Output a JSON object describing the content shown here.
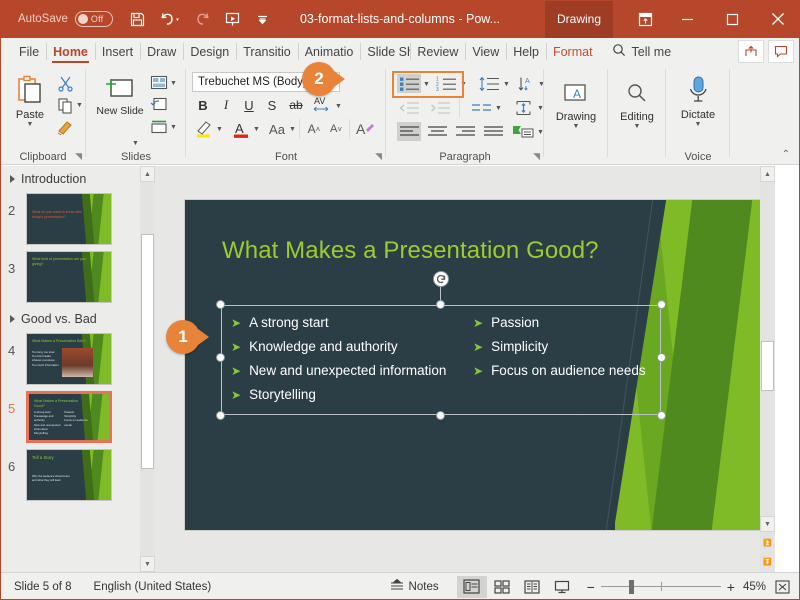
{
  "titlebar": {
    "autosave_label": "AutoSave",
    "autosave_state": "Off",
    "document_title": "03-format-lists-and-columns  -  Pow...",
    "context_tab": "Drawing",
    "quick_access": [
      "save-icon",
      "undo-icon",
      "redo-icon",
      "start-presentation-icon",
      "customize-qat-icon"
    ],
    "window_buttons": [
      "ribbon-display-options",
      "minimize",
      "maximize",
      "close"
    ]
  },
  "tabs": [
    {
      "label": "File",
      "state": "normal"
    },
    {
      "label": "Home",
      "state": "active"
    },
    {
      "label": "Insert",
      "state": "normal"
    },
    {
      "label": "Draw",
      "state": "normal"
    },
    {
      "label": "Design",
      "state": "normal"
    },
    {
      "label": "Transitio",
      "state": "normal"
    },
    {
      "label": "Animatio",
      "state": "normal"
    },
    {
      "label": "Slide Sho",
      "state": "normal"
    },
    {
      "label": "Review",
      "state": "normal"
    },
    {
      "label": "View",
      "state": "normal"
    },
    {
      "label": "Help",
      "state": "normal"
    },
    {
      "label": "Format",
      "state": "contextual"
    }
  ],
  "tellme": {
    "label": "Tell me",
    "icon": "search-icon"
  },
  "ribbon": {
    "groups": [
      {
        "name": "Clipboard",
        "label": "Clipboard"
      },
      {
        "name": "Slides",
        "label": "Slides"
      },
      {
        "name": "Font",
        "label": "Font"
      },
      {
        "name": "Paragraph",
        "label": "Paragraph"
      },
      {
        "name": "Drawing",
        "label": ""
      },
      {
        "name": "Editing",
        "label": ""
      },
      {
        "name": "Voice",
        "label": "Voice"
      }
    ],
    "clipboard": {
      "paste_label": "Paste",
      "cut": "scissors-icon",
      "copy": "copy-icon",
      "format_painter": "format-painter-icon"
    },
    "slides": {
      "new_slide_label": "New Slide",
      "layout": "layout-icon",
      "reset": "reset-icon",
      "section": "section-icon"
    },
    "font": {
      "font_name": "Trebuchet MS (Body)",
      "bold": "B",
      "italic": "I",
      "underline": "U",
      "shadow": "S",
      "strikethrough": "ab",
      "character_spacing": "AV",
      "text_highlight": "highlight-icon",
      "font_color": "A",
      "change_case": "Aa",
      "grow_font": "A",
      "shrink_font": "A",
      "clear_formatting": "clear-formatting-icon"
    },
    "paragraph": {
      "bullets": "bullets-icon",
      "numbering": "numbering-icon",
      "line_spacing": "line-spacing-icon",
      "text_direction_sort": "sort-icon",
      "decrease_indent": "decrease-indent-icon",
      "increase_indent": "increase-indent-icon",
      "columns": "columns-icon",
      "align_text": "align-text-icon",
      "align_left": "align-left-icon",
      "align_center": "align-center-icon",
      "align_right": "align-right-icon",
      "justify": "justify-icon",
      "convert_smartart": "smartart-icon",
      "bullets_active": true,
      "align_left_active": true
    },
    "drawing": {
      "label": "Drawing",
      "icon": "shapes-text-icon"
    },
    "editing": {
      "label": "Editing",
      "icon": "search-icon"
    },
    "voice": {
      "label": "Dictate",
      "icon": "microphone-icon"
    },
    "collapse_ribbon": "chevron-up-icon"
  },
  "callouts": [
    {
      "number": "1",
      "target": "text-box-left-handle"
    },
    {
      "number": "2",
      "target": "bullets-button"
    }
  ],
  "thumbnails": {
    "sections": [
      {
        "name": "Introduction",
        "expanded": true
      },
      {
        "name": "Good vs. Bad",
        "expanded": true
      }
    ],
    "slides": [
      {
        "number": "2",
        "title": "What do you want to know after today's presentation?",
        "selected": false,
        "title_color": "#e05a30",
        "lines": []
      },
      {
        "number": "3",
        "title": "What kind of presentation are you giving?",
        "selected": false,
        "title_color": "#8cc63e",
        "lines": []
      },
      {
        "number": "4",
        "title": "What Makes a Presentation Bad?",
        "selected": false,
        "title_color": "#8cc63e",
        "lines": [
          "Too long, too slow",
          "Too few breaks",
          "Lifeless monotone",
          "Too much information"
        ],
        "has_photo": true
      },
      {
        "number": "5",
        "title": "What Makes a Presentation Good?",
        "selected": true,
        "title_color": "#8cc63e",
        "lines": [
          "A strong start",
          "Knowledge and authority",
          "New and unexpected information",
          "Storytelling"
        ],
        "lines2": [
          "Passion",
          "Simplicity",
          "Focus on audience needs"
        ]
      },
      {
        "number": "6",
        "title": "Tell a Story",
        "selected": false,
        "title_color": "#8cc63e",
        "lines": [
          "Why the audience should care",
          "and what they will learn"
        ]
      }
    ]
  },
  "slide": {
    "title": "What Makes a Presentation Good?",
    "title_color": "#9acd32",
    "background_color": "#2b3d45",
    "bullet_glyph": "➤",
    "column1": [
      "A strong start",
      "Knowledge and authority",
      "New and unexpected information",
      "Storytelling"
    ],
    "column2": [
      "Passion",
      "Simplicity",
      "Focus on audience needs"
    ],
    "selected": true
  },
  "statusbar": {
    "slide_counter": "Slide 5 of 8",
    "language": "English (United States)",
    "notes_label": "Notes",
    "views": [
      "normal-view",
      "slide-sorter-view",
      "reading-view",
      "slide-show-view"
    ],
    "active_view": "normal-view",
    "zoom_out": "−",
    "zoom_in": "+",
    "zoom_level": "45%",
    "fit_to_window": "fit-slide-icon"
  },
  "colors": {
    "title_bar": "#b7472a",
    "accent_orange": "#e8833a",
    "slide_green": "#7fba27",
    "selection_orange": "#e8715a"
  }
}
